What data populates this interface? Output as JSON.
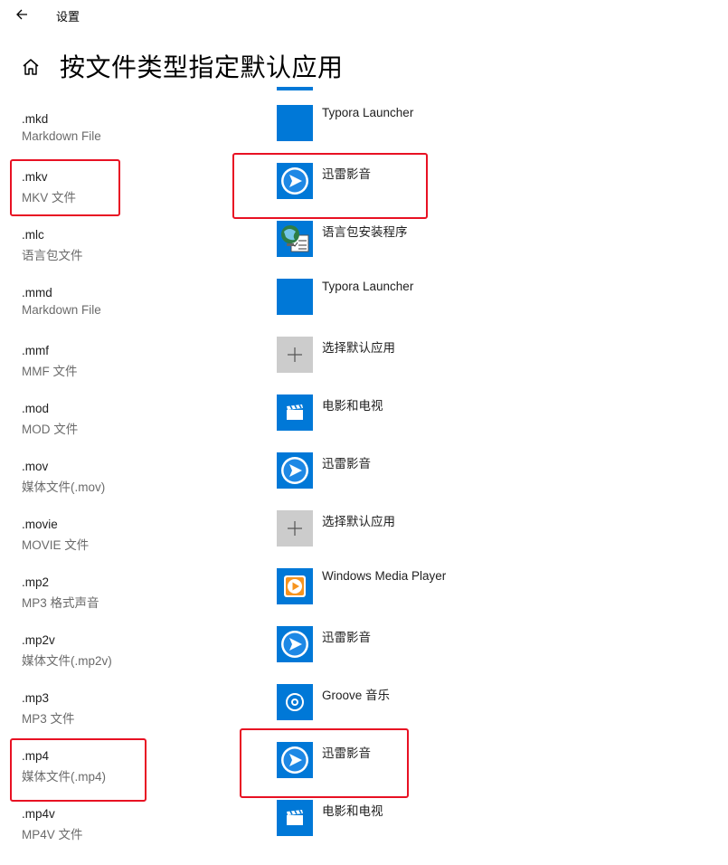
{
  "window": {
    "title": "设置"
  },
  "page": {
    "title": "按文件类型指定默认应用"
  },
  "colors": {
    "accent": "#0078d7",
    "highlight": "#e81123",
    "empty_tile": "#cccccc"
  },
  "rows": [
    {
      "ext": ".mkd",
      "desc": "Markdown File",
      "app": "Typora Launcher",
      "icon": "blank-blue-tile"
    },
    {
      "ext": ".mkv",
      "desc": "MKV 文件",
      "app": "迅雷影音",
      "icon": "xunlei-icon"
    },
    {
      "ext": ".mlc",
      "desc": "语言包文件",
      "app": "语言包安装程序",
      "icon": "language-pack-icon"
    },
    {
      "ext": ".mmd",
      "desc": "Markdown File",
      "app": "Typora Launcher",
      "icon": "blank-blue-tile"
    },
    {
      "ext": ".mmf",
      "desc": "MMF 文件",
      "app": "选择默认应用",
      "icon": "plus-icon"
    },
    {
      "ext": ".mod",
      "desc": "MOD 文件",
      "app": "电影和电视",
      "icon": "film-icon"
    },
    {
      "ext": ".mov",
      "desc": "媒体文件(.mov)",
      "app": "迅雷影音",
      "icon": "xunlei-icon"
    },
    {
      "ext": ".movie",
      "desc": "MOVIE 文件",
      "app": "选择默认应用",
      "icon": "plus-icon"
    },
    {
      "ext": ".mp2",
      "desc": "MP3 格式声音",
      "app": "Windows Media Player",
      "icon": "wmp-icon"
    },
    {
      "ext": ".mp2v",
      "desc": "媒体文件(.mp2v)",
      "app": "迅雷影音",
      "icon": "xunlei-icon"
    },
    {
      "ext": ".mp3",
      "desc": "MP3 文件",
      "app": "Groove 音乐",
      "icon": "groove-icon"
    },
    {
      "ext": ".mp4",
      "desc": "媒体文件(.mp4)",
      "app": "迅雷影音",
      "icon": "xunlei-icon"
    },
    {
      "ext": ".mp4v",
      "desc": "MP4V 文件",
      "app": "电影和电视",
      "icon": "film-icon"
    }
  ]
}
